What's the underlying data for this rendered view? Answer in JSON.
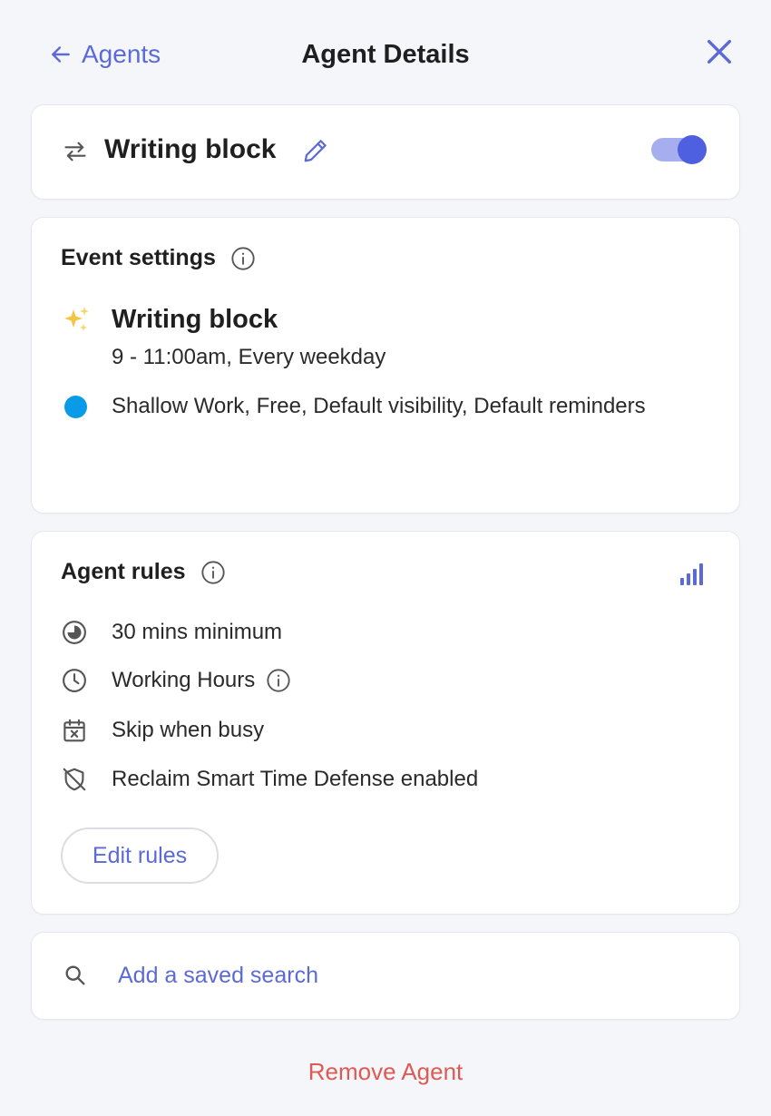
{
  "header": {
    "back_label": "Agents",
    "title": "Agent Details",
    "close_icon": "close-icon"
  },
  "agent": {
    "name": "Writing block",
    "enabled": true,
    "toggle_color": "#4e5fe0"
  },
  "event_settings": {
    "title": "Event settings",
    "event_title": "Writing block",
    "event_time": "9 - 11:00am, Every weekday",
    "details": "Shallow Work, Free, Default visibility, Default reminders",
    "color": "#0a9be8",
    "emoji_icon": "sparkles-icon"
  },
  "agent_rules": {
    "title": "Agent rules",
    "rules": [
      {
        "icon": "duration-icon",
        "label": "30 mins minimum"
      },
      {
        "icon": "clock-icon",
        "label": "Working Hours"
      },
      {
        "icon": "calendar-x-icon",
        "label": "Skip when busy"
      },
      {
        "icon": "shield-off-icon",
        "label": "Reclaim Smart Time Defense enabled"
      }
    ],
    "edit_label": "Edit rules"
  },
  "saved_search": {
    "label": "Add a saved search"
  },
  "remove_label": "Remove Agent",
  "colors": {
    "accent": "#5b6ad6",
    "danger": "#de5a55",
    "background": "#f5f6fa"
  }
}
